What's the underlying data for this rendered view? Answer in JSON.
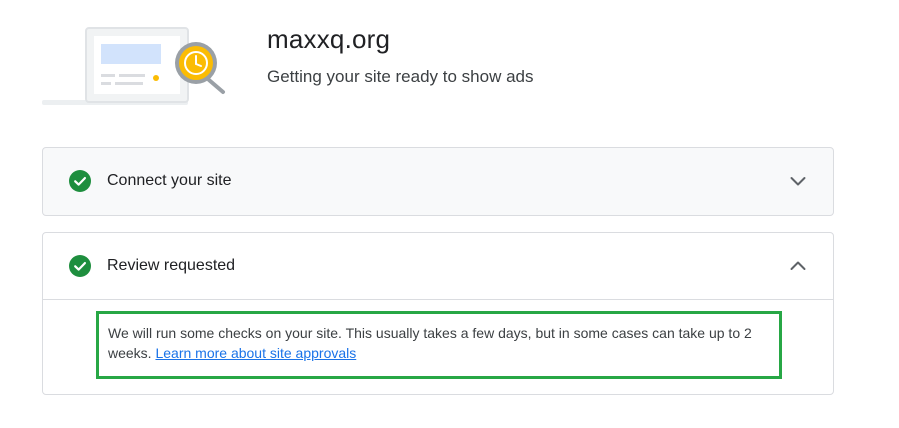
{
  "header": {
    "site_name": "maxxq.org",
    "subtitle": "Getting your site ready to show ads"
  },
  "steps": [
    {
      "title": "Connect your site",
      "status": "complete",
      "expanded": false,
      "icon": "check-circle-icon",
      "toggle_icon": "chevron-down-icon"
    },
    {
      "title": "Review requested",
      "status": "complete",
      "expanded": true,
      "icon": "check-circle-icon",
      "toggle_icon": "chevron-up-icon",
      "body_text": "We will run some checks on your site. This usually takes a few days, but in some cases can take up to 2 weeks.",
      "link_text": "Learn more about site approvals"
    }
  ],
  "colors": {
    "success": "#1e8e3e",
    "link": "#1a73e8",
    "highlight_border": "#27a745",
    "illustration_accent": "#fbbc04"
  }
}
